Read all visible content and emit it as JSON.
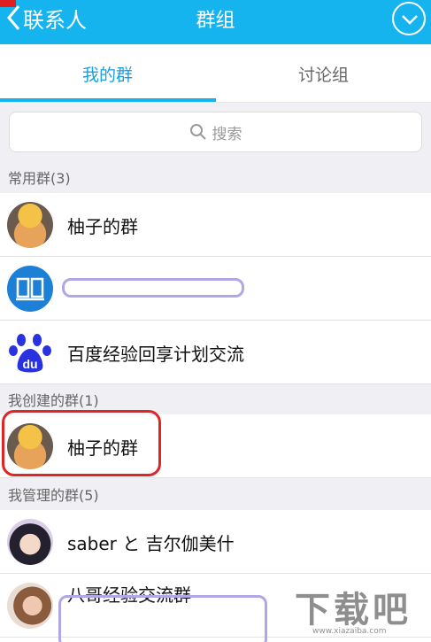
{
  "header": {
    "back_label": "联系人",
    "title": "群组",
    "background_color": "#16b4ee"
  },
  "tabs": [
    {
      "label": "我的群",
      "active": true
    },
    {
      "label": "讨论组",
      "active": false
    }
  ],
  "search": {
    "placeholder": "搜索"
  },
  "sections": [
    {
      "title": "常用群(3)",
      "groups": [
        {
          "name": "柚子的群",
          "avatar": "naruto-avatar"
        },
        {
          "name": "",
          "avatar": "book-icon"
        },
        {
          "name": "百度经验回享计划交流",
          "avatar": "baidu-paw-icon"
        }
      ]
    },
    {
      "title": "我创建的群(1)",
      "groups": [
        {
          "name": "柚子的群",
          "avatar": "naruto-avatar"
        }
      ]
    },
    {
      "title": "我管理的群(5)",
      "groups": [
        {
          "name": "saber と 吉尔伽美什",
          "avatar": "hinata-avatar"
        },
        {
          "name": "八哥经验交流群",
          "avatar": "girl-avatar"
        }
      ]
    }
  ],
  "watermark": {
    "brand": "下载吧",
    "url": "www.xiazaiba.com"
  },
  "colors": {
    "accent": "#16b4ee",
    "active_tab": "#1aa0e0",
    "highlight": "#e12424"
  }
}
